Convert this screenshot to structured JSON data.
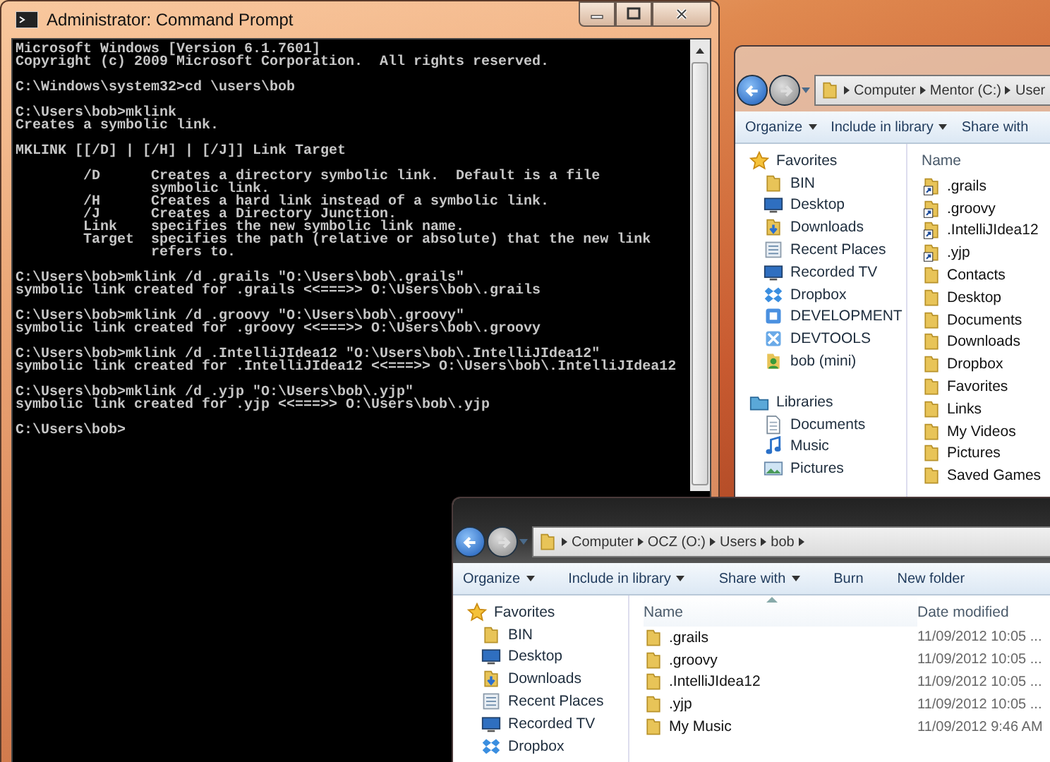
{
  "console_window": {
    "title": "Administrator: Command Prompt",
    "blocks": [
      [
        "Microsoft Windows [Version 6.1.7601]",
        "Copyright (c) 2009 Microsoft Corporation.  All rights reserved."
      ],
      [
        "C:\\Windows\\system32>cd \\users\\bob"
      ],
      [
        "C:\\Users\\bob>mklink",
        "Creates a symbolic link."
      ],
      [
        "MKLINK [[/D] | [/H] | [/J]] Link Target"
      ],
      [
        "        /D      Creates a directory symbolic link.  Default is a file",
        "                symbolic link.",
        "        /H      Creates a hard link instead of a symbolic link.",
        "        /J      Creates a Directory Junction.",
        "        Link    specifies the new symbolic link name.",
        "        Target  specifies the path (relative or absolute) that the new link",
        "                refers to."
      ],
      [
        "C:\\Users\\bob>mklink /d .grails \"O:\\Users\\bob\\.grails\"",
        "symbolic link created for .grails <<===>> O:\\Users\\bob\\.grails"
      ],
      [
        "C:\\Users\\bob>mklink /d .groovy \"O:\\Users\\bob\\.groovy\"",
        "symbolic link created for .groovy <<===>> O:\\Users\\bob\\.groovy"
      ],
      [
        "C:\\Users\\bob>mklink /d .IntelliJIdea12 \"O:\\Users\\bob\\.IntelliJIdea12\"",
        "symbolic link created for .IntelliJIdea12 <<===>> O:\\Users\\bob\\.IntelliJIdea12"
      ],
      [
        "C:\\Users\\bob>mklink /d .yjp \"O:\\Users\\bob\\.yjp\"",
        "symbolic link created for .yjp <<===>> O:\\Users\\bob\\.yjp"
      ],
      [
        "C:\\Users\\bob>"
      ]
    ]
  },
  "explorer_windows": [
    {
      "breadcrumbs": [
        "Computer",
        "Mentor (C:)",
        "User"
      ],
      "trailing_arrow": false,
      "toolbar": [
        {
          "label": "Organize",
          "dropdown": true
        },
        {
          "label": "Include in library",
          "dropdown": true
        },
        {
          "label": "Share with",
          "dropdown": false
        }
      ],
      "sidebar": [
        {
          "label": "Favorites",
          "kind": "favorites"
        },
        {
          "label": "BIN",
          "kind": "folder"
        },
        {
          "label": "Desktop",
          "kind": "desktop"
        },
        {
          "label": "Downloads",
          "kind": "downloads"
        },
        {
          "label": "Recent Places",
          "kind": "recent"
        },
        {
          "label": "Recorded TV",
          "kind": "tv"
        },
        {
          "label": "Dropbox",
          "kind": "dropbox"
        },
        {
          "label": "DEVELOPMENT",
          "kind": "drive"
        },
        {
          "label": "DEVTOOLS",
          "kind": "tools"
        },
        {
          "label": "bob (mini)",
          "kind": "user"
        },
        {
          "label": "Libraries",
          "kind": "libraries"
        },
        {
          "label": "Documents",
          "kind": "documents"
        },
        {
          "label": "Music",
          "kind": "music"
        },
        {
          "label": "Pictures",
          "kind": "pictures"
        }
      ],
      "columns": [
        {
          "label": "Name",
          "sorted": false
        }
      ],
      "files": [
        {
          "name": ".grails",
          "shortcut": true
        },
        {
          "name": ".groovy",
          "shortcut": true
        },
        {
          "name": ".IntelliJIdea12",
          "shortcut": true
        },
        {
          "name": ".yjp",
          "shortcut": true
        },
        {
          "name": "Contacts",
          "shortcut": false
        },
        {
          "name": "Desktop",
          "shortcut": false
        },
        {
          "name": "Documents",
          "shortcut": false
        },
        {
          "name": "Downloads",
          "shortcut": false
        },
        {
          "name": "Dropbox",
          "shortcut": false
        },
        {
          "name": "Favorites",
          "shortcut": false
        },
        {
          "name": "Links",
          "shortcut": false
        },
        {
          "name": "My Videos",
          "shortcut": false
        },
        {
          "name": "Pictures",
          "shortcut": false
        },
        {
          "name": "Saved Games",
          "shortcut": false
        }
      ]
    },
    {
      "breadcrumbs": [
        "Computer",
        "OCZ (O:)",
        "Users",
        "bob"
      ],
      "trailing_arrow": true,
      "toolbar": [
        {
          "label": "Organize",
          "dropdown": true
        },
        {
          "label": "Include in library",
          "dropdown": true
        },
        {
          "label": "Share with",
          "dropdown": true
        },
        {
          "label": "Burn",
          "dropdown": false
        },
        {
          "label": "New folder",
          "dropdown": false
        }
      ],
      "sidebar": [
        {
          "label": "Favorites",
          "kind": "favorites"
        },
        {
          "label": "BIN",
          "kind": "folder"
        },
        {
          "label": "Desktop",
          "kind": "desktop"
        },
        {
          "label": "Downloads",
          "kind": "downloads"
        },
        {
          "label": "Recent Places",
          "kind": "recent"
        },
        {
          "label": "Recorded TV",
          "kind": "tv"
        },
        {
          "label": "Dropbox",
          "kind": "dropbox"
        }
      ],
      "columns": [
        {
          "label": "Name",
          "sorted": true
        },
        {
          "label": "Date modified",
          "sorted": false
        }
      ],
      "files": [
        {
          "name": ".grails",
          "shortcut": false,
          "date": "11/09/2012 10:05 ..."
        },
        {
          "name": ".groovy",
          "shortcut": false,
          "date": "11/09/2012 10:05 ..."
        },
        {
          "name": ".IntelliJIdea12",
          "shortcut": false,
          "date": "11/09/2012 10:05 ..."
        },
        {
          "name": ".yjp",
          "shortcut": false,
          "date": "11/09/2012 10:05 ..."
        },
        {
          "name": "My Music",
          "shortcut": false,
          "date": "11/09/2012 9:46 AM"
        }
      ]
    }
  ]
}
